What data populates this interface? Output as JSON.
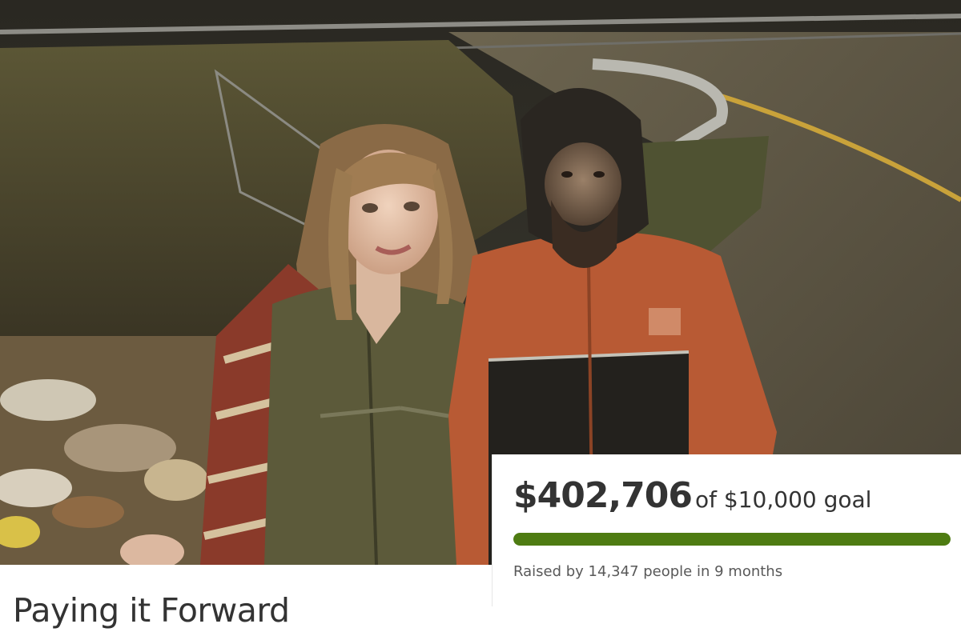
{
  "campaign": {
    "title": "Paying it Forward",
    "photo_description_icon": "campaign-photo",
    "raised": {
      "amount": "$402,706",
      "goal_text": "of $10,000 goal",
      "progress_fraction": 1.0,
      "summary": "Raised by 14,347 people in 9 months"
    }
  },
  "colors": {
    "progress": "#4e7c12",
    "track": "#e0e0e0",
    "text": "#333333",
    "muted": "#595959"
  }
}
